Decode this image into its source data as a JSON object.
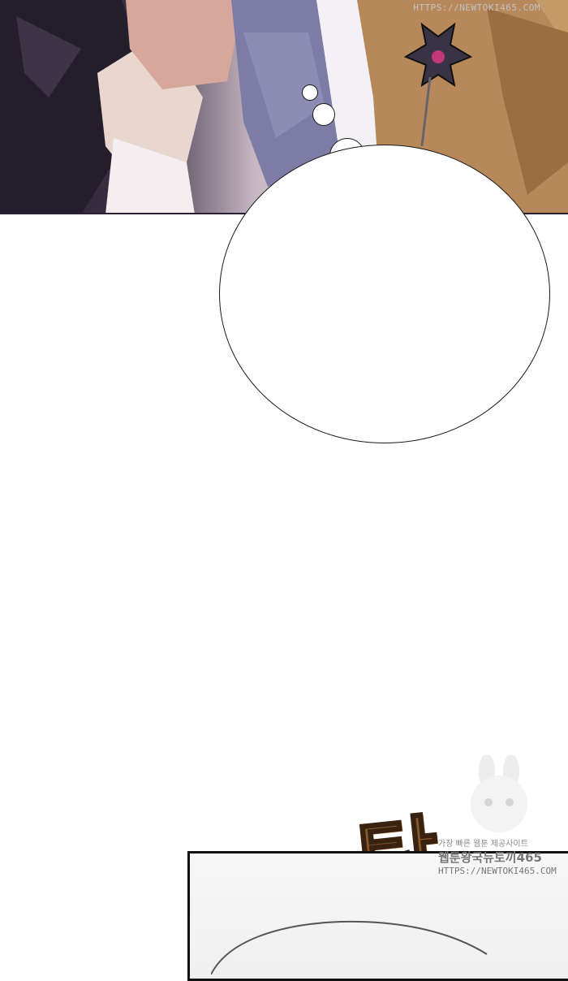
{
  "watermark": {
    "url": "HTTPS://NEWTOKI465.COM",
    "site_line1": "가장 빠른 웹툰 제공사이트",
    "site_line2": "웹툰왕국뉴토끼465",
    "url2": "HTTPS://NEWTOKI465.COM"
  },
  "sound_effect": "탁"
}
